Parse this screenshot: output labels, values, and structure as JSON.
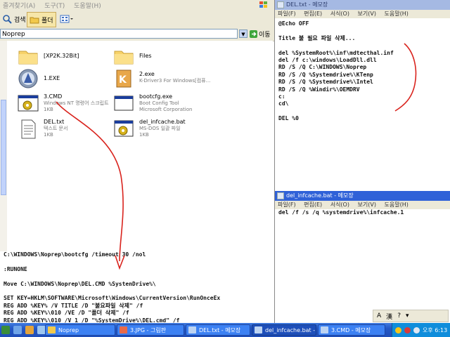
{
  "explorer": {
    "menu": [
      "즐겨찾기(A)",
      "도구(T)",
      "도움말(H)"
    ],
    "toolbar": {
      "search_label": "검색",
      "folders_label": "폴더"
    },
    "address": {
      "value": "Noprep",
      "go_label": "이동"
    },
    "files": [
      {
        "name": "[XP2K.32Bit]",
        "sub1": "",
        "sub2": "",
        "icon": "folder-icon"
      },
      {
        "name": "Files",
        "sub1": "",
        "sub2": "",
        "icon": "folder-icon"
      },
      {
        "name": "1.EXE",
        "sub1": "",
        "sub2": "",
        "icon": "app-icon"
      },
      {
        "name": "2.exe",
        "sub1": "K-Driver3 For Windows[컴퓨...",
        "sub2": "",
        "icon": "installer-icon"
      },
      {
        "name": "3.CMD",
        "sub1": "Windows NT 명령어 스크립트",
        "sub2": "1KB",
        "icon": "cmd-script-icon"
      },
      {
        "name": "bootcfg.exe",
        "sub1": "Boot Config Tool",
        "sub2": "Microsoft Corporation",
        "icon": "exe-icon"
      },
      {
        "name": "DEL.txt",
        "sub1": "텍스트 문서",
        "sub2": "1KB",
        "icon": "text-doc-icon"
      },
      {
        "name": "del_infcache.bat",
        "sub1": "MS-DOS 일괄 파일",
        "sub2": "1KB",
        "icon": "batch-file-icon"
      }
    ]
  },
  "notepad_del": {
    "title": "DEL.txt - 메모장",
    "menu": [
      "파일(F)",
      "편집(E)",
      "서식(O)",
      "보기(V)",
      "도움말(H)"
    ],
    "content": "@Echo OFF\n\nTitle 불 필요 파일 삭제...\n\ndel %SystemRoot%\\inf\\mdtecthal.inf\ndel /f c:\\windows\\LoadDll.dll\nRD /S /Q C:\\WINDOWS\\Noprep\nRD /S /Q %Systemdrive%\\KTenp\nRD /S /Q %Systemdrive%\\Intel\nRD /S /Q %Windir%\\OEMDRV\nc:\ncd\\\n\nDEL %0"
  },
  "notepad_infcache": {
    "title": "del_infcache.bat - 메모장",
    "menu": [
      "파일(F)",
      "편집(E)",
      "서식(O)",
      "보기(V)",
      "도움말(H)"
    ],
    "content": "del /f /s /q %systemdrive%\\infcache.1"
  },
  "notepad_cmd": {
    "content": "C:\\WINDOWS\\Noprep\\bootcfg /timeout 30 /nol\n\n:RUNONE\n\nMove C:\\WINDOWS\\Noprep\\DEL.CMD %SystenDrive%\\\n\nSET KEY=HKLM\\SOFTWARE\\Microsoft\\Windows\\CurrentVersion\\RunOnceEx\nREG ADD %KEY% /V TITLE /D \"불요파일 삭제\" /f\nREG ADD %KEY%\\010 /VE /D \"폴더 삭제\" /f\nREG ADD %KEY%\\010 /V 1 /D \"%SystemDrive%\\DEL.cmd\" /f"
  },
  "ime": {
    "lang": "A",
    "mode": "漢",
    "help": "?"
  },
  "taskbar": {
    "tasks": [
      {
        "label": "Noprep",
        "icon": "folder-icon"
      },
      {
        "label": "3.JPG - 그림판",
        "icon": "paint-icon"
      },
      {
        "label": "DEL.txt - 메모장",
        "icon": "notepad-icon"
      },
      {
        "label": "del_infcache.bat - ...",
        "icon": "notepad-icon"
      },
      {
        "label": "3.CMD - 메모장",
        "icon": "notepad-icon"
      }
    ],
    "clock": "오후 6:13"
  },
  "colors": {
    "taskbar": "#2457c5",
    "titlebar_active": "#2f61d8",
    "annotation": "#d9231d"
  }
}
